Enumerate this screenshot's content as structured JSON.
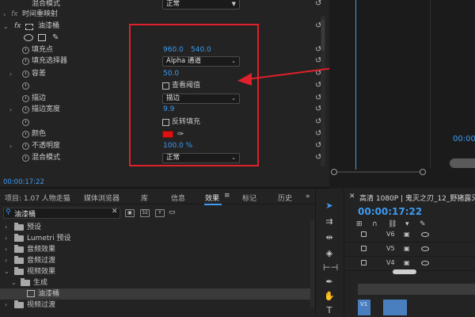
{
  "effect_controls": {
    "rows": [
      {
        "label": "混合模式",
        "value": "正常",
        "kind": "dropdown"
      },
      {
        "label": "时间重映射",
        "kind": "section"
      },
      {
        "label": "油漆桶",
        "kind": "effect-header",
        "fx": "fx"
      },
      {
        "label": "填充点",
        "value": "960.0",
        "value2": "540.0",
        "kind": "value"
      },
      {
        "label": "填充选择器",
        "value": "Alpha 通道",
        "kind": "dropdown"
      },
      {
        "label": "容差",
        "value": "50.0",
        "kind": "value"
      },
      {
        "label": "查看阈值",
        "kind": "checkbox"
      },
      {
        "label": "描边",
        "value": "描边",
        "kind": "dropdown"
      },
      {
        "label": "描边宽度",
        "value": "9.9",
        "kind": "value"
      },
      {
        "label": "反转填充",
        "kind": "checkbox"
      },
      {
        "label": "颜色",
        "kind": "color",
        "color": "#e01010"
      },
      {
        "label": "不透明度",
        "value": "100.0 %",
        "kind": "value"
      },
      {
        "label": "混合模式",
        "value": "正常",
        "kind": "dropdown"
      }
    ],
    "timecode": "00:00:17:22",
    "highlight_color": "#e0202a",
    "arrow_color": "#e0202a"
  },
  "program_monitor": {
    "timecode": "00:00"
  },
  "effects_panel": {
    "tabs": [
      {
        "label": "项目: 1.07 人物走猫"
      },
      {
        "label": "媒体浏览器"
      },
      {
        "label": "库"
      },
      {
        "label": "信息"
      },
      {
        "label": "效果",
        "active": true
      },
      {
        "label": "标记"
      },
      {
        "label": "历史"
      }
    ],
    "search": {
      "value": "油漆桶"
    },
    "tree": [
      {
        "label": "预设",
        "level": 0
      },
      {
        "label": "Lumetri 预设",
        "level": 0
      },
      {
        "label": "音频效果",
        "level": 0
      },
      {
        "label": "音频过渡",
        "level": 0
      },
      {
        "label": "视频效果",
        "level": 0,
        "expanded": true
      },
      {
        "label": "生成",
        "level": 1,
        "expanded": true
      },
      {
        "label": "油漆桶",
        "level": 2,
        "selected": true,
        "kind": "effect"
      },
      {
        "label": "视频过渡",
        "level": 0
      }
    ]
  },
  "timeline": {
    "sequence_name": "高清 1080P | 鬼灭之刃_12_野猪露牙 善",
    "timecode": "00:00:17:22",
    "tracks": [
      {
        "name": "V6"
      },
      {
        "name": "V5"
      },
      {
        "name": "V4"
      }
    ],
    "clip_label": "V1"
  }
}
